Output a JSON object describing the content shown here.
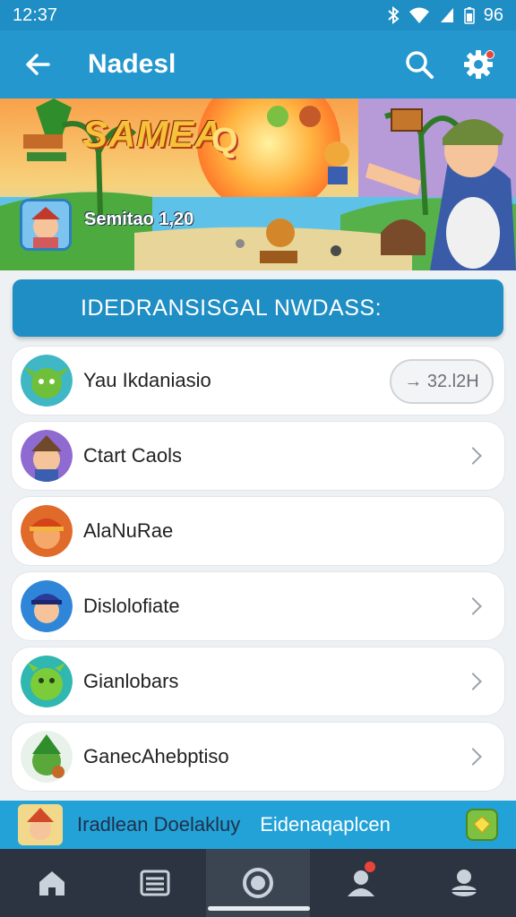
{
  "status_bar": {
    "time": "12:37",
    "battery": "96"
  },
  "app_bar": {
    "title": "Nadesl"
  },
  "banner": {
    "title": "SAMEA",
    "q_letter": "Q",
    "score_label": "Semitao 1,20"
  },
  "section_header": {
    "label": "IDEDRANSISGAL   NWDASS:"
  },
  "list_items": [
    {
      "label": "Yau Ikdaniasio",
      "action": "pill",
      "pill_label": "→ 32.l2H"
    },
    {
      "label": "Ctart Caols",
      "action": "chevron"
    },
    {
      "label": "AlaNuRae",
      "action": "none"
    },
    {
      "label": "Dislolofiate",
      "action": "chevron"
    },
    {
      "label": "Gianlobars",
      "action": "chevron"
    },
    {
      "label": "GanecAhebptiso",
      "action": "chevron"
    }
  ],
  "promo": {
    "left_text": "Iradlean Doelakluy",
    "right_text": "Eidenaqaplcen"
  },
  "bottom_nav": [
    "home",
    "list",
    "record",
    "profile",
    "account"
  ],
  "colors": {
    "primary": "#2497cf",
    "status_bar": "#1f8ec4",
    "nav_bg": "#2b3440",
    "badge": "#e9443a"
  }
}
